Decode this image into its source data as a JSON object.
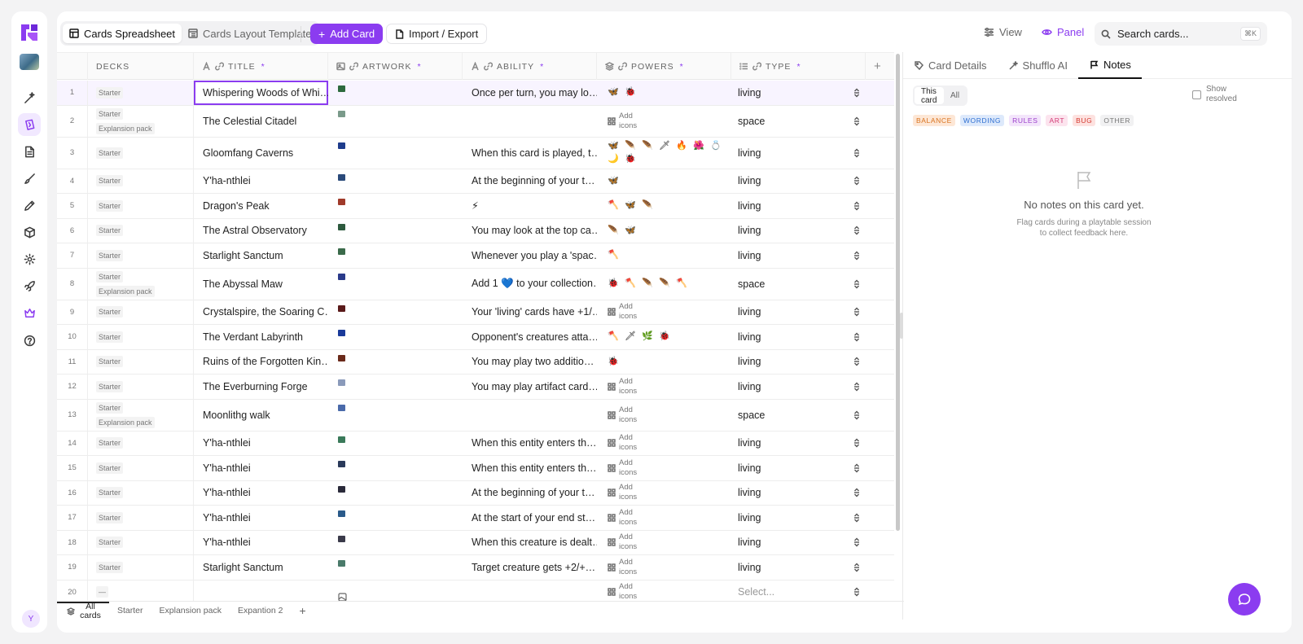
{
  "header": {
    "tabs": [
      {
        "label": "Cards Spreadsheet",
        "active": true
      },
      {
        "label": "Cards Layout Template",
        "active": false
      }
    ],
    "add_card_label": "Add Card",
    "import_export_label": "Import / Export",
    "view_label": "View",
    "panel_label": "Panel",
    "search_placeholder": "Search cards...",
    "search_shortcut": "⌘K"
  },
  "sidebar": {
    "items": [
      "wand-icon",
      "cards-icon",
      "document-icon",
      "brush-icon",
      "pen-icon",
      "package-icon",
      "settings-icon",
      "rocket-icon",
      "crown-icon",
      "help-icon"
    ],
    "active_item": "cards-icon",
    "avatar_initial": "Y"
  },
  "columns": [
    {
      "label": "DECKS",
      "required": false
    },
    {
      "label": "TITLE",
      "required": true
    },
    {
      "label": "ARTWORK",
      "required": true
    },
    {
      "label": "ABILITY",
      "required": true
    },
    {
      "label": "POWERS",
      "required": true
    },
    {
      "label": "TYPE",
      "required": true
    }
  ],
  "add_icons_label": "Add icons",
  "type_placeholder": "Select...",
  "colors": {
    "accent": "#8b3cf0"
  },
  "rows": [
    {
      "num": "1",
      "decks": [
        "Starter"
      ],
      "title": "Whispering Woods of Whi…",
      "ability": "Once per turn, you may lo…",
      "powers": [
        "🦋",
        "🐞"
      ],
      "type": "living",
      "art": "#2d6a3e"
    },
    {
      "num": "2",
      "decks": [
        "Starter",
        "Explansion pack"
      ],
      "title": "The Celestial Citadel",
      "ability": "",
      "powers": [],
      "type": "space",
      "art": "#7a9a8a"
    },
    {
      "num": "3",
      "decks": [
        "Starter"
      ],
      "title": "Gloomfang Caverns",
      "ability": "When this card is played, t…",
      "powers": [
        "🦋",
        "🪶",
        "🪶",
        "🗡",
        "🔥",
        "🌺",
        "💍",
        "🌙",
        "🐞"
      ],
      "type": "living",
      "art": "#1e3c8c"
    },
    {
      "num": "4",
      "decks": [
        "Starter"
      ],
      "title": "Y'ha-nthlei",
      "ability": "At the beginning of your t…",
      "powers": [
        "🦋"
      ],
      "type": "living",
      "art": "#2a4a7a"
    },
    {
      "num": "5",
      "decks": [
        "Starter"
      ],
      "title": "Dragon's Peak",
      "ability": "⚡",
      "powers": [
        "🪓",
        "🦋",
        "🪶"
      ],
      "type": "living",
      "art": "#a03a2a"
    },
    {
      "num": "6",
      "decks": [
        "Starter"
      ],
      "title": "The Astral Observatory",
      "ability": "You may look at the top ca…",
      "powers": [
        "🪶",
        "🦋"
      ],
      "type": "living",
      "art": "#2d5a3e"
    },
    {
      "num": "7",
      "decks": [
        "Starter"
      ],
      "title": "Starlight Sanctum",
      "ability": "Whenever you play a 'spac…",
      "powers": [
        "🪓"
      ],
      "type": "living",
      "art": "#3a6a4a"
    },
    {
      "num": "8",
      "decks": [
        "Starter",
        "Explansion pack"
      ],
      "title": "The Abyssal Maw",
      "ability": "Add 1 💙 to your collection…",
      "powers": [
        "🐞",
        "🪓",
        "🪶",
        "🪶",
        "🪓"
      ],
      "type": "space",
      "art": "#2a3a8a"
    },
    {
      "num": "9",
      "decks": [
        "Starter"
      ],
      "title": "Crystalspire, the Soaring C…",
      "ability": "Your 'living' cards have +1/…",
      "powers": [],
      "type": "living",
      "art": "#5a1a1a"
    },
    {
      "num": "10",
      "decks": [
        "Starter"
      ],
      "title": "The Verdant Labyrinth",
      "ability": "Opponent's creatures atta…",
      "powers": [
        "🪓",
        "🗡",
        "🌿",
        "🐞"
      ],
      "type": "living",
      "art": "#1a3a9a"
    },
    {
      "num": "11",
      "decks": [
        "Starter"
      ],
      "title": "Ruins of the Forgotten Kin…",
      "ability": "You may play two additio…",
      "powers": [
        "🐞"
      ],
      "type": "living",
      "art": "#6a2a1a"
    },
    {
      "num": "12",
      "decks": [
        "Starter"
      ],
      "title": "The Everburning Forge",
      "ability": "You may play artifact card…",
      "powers": [],
      "type": "living",
      "art": "#8a9aba"
    },
    {
      "num": "13",
      "decks": [
        "Starter",
        "Explansion pack"
      ],
      "title": "Moonlithg walk",
      "ability": "",
      "powers": [],
      "type": "space",
      "art": "#4a6aaa"
    },
    {
      "num": "14",
      "decks": [
        "Starter"
      ],
      "title": "Y'ha-nthlei",
      "ability": "When this entity enters th…",
      "powers": [],
      "type": "living",
      "art": "#3a7a5a"
    },
    {
      "num": "15",
      "decks": [
        "Starter"
      ],
      "title": "Y'ha-nthlei",
      "ability": "When this entity enters th…",
      "powers": [],
      "type": "living",
      "art": "#2a3a5a"
    },
    {
      "num": "16",
      "decks": [
        "Starter"
      ],
      "title": "Y'ha-nthlei",
      "ability": "At the beginning of your t…",
      "powers": [],
      "type": "living",
      "art": "#2a2a3a"
    },
    {
      "num": "17",
      "decks": [
        "Starter"
      ],
      "title": "Y'ha-nthlei",
      "ability": "At the start of your end st…",
      "powers": [],
      "type": "living",
      "art": "#2a5a8a"
    },
    {
      "num": "18",
      "decks": [
        "Starter"
      ],
      "title": "Y'ha-nthlei",
      "ability": "When this creature is dealt…",
      "powers": [],
      "type": "living",
      "art": "#3a3a4a"
    },
    {
      "num": "19",
      "decks": [
        "Starter"
      ],
      "title": "Starlight Sanctum",
      "ability": "Target creature gets +2/+…",
      "powers": [],
      "type": "living",
      "art": "#4a7a6a"
    },
    {
      "num": "20",
      "decks": [
        "—"
      ],
      "title": "",
      "ability": "",
      "powers": [],
      "type": "",
      "art": ""
    }
  ],
  "bottom_tabs": [
    "All cards",
    "Starter",
    "Explansion pack",
    "Expantion 2"
  ],
  "panel": {
    "tabs": [
      "Card Details",
      "Shufflo AI",
      "Notes"
    ],
    "active_tab": "Notes",
    "scope": [
      "This card",
      "All"
    ],
    "show_resolved_label": "Show resolved",
    "chips": [
      {
        "label": "BALANCE",
        "bg": "#fde7d6",
        "fg": "#d9731f"
      },
      {
        "label": "WORDING",
        "bg": "#dde9fb",
        "fg": "#2f6fd1"
      },
      {
        "label": "RULES",
        "bg": "#f3e5fb",
        "fg": "#9c3fcb"
      },
      {
        "label": "ART",
        "bg": "#fce4ee",
        "fg": "#d33b76"
      },
      {
        "label": "BUG",
        "bg": "#fde2e0",
        "fg": "#d4382f"
      },
      {
        "label": "OTHER",
        "bg": "#f1f1f2",
        "fg": "#777777"
      }
    ],
    "empty_title": "No notes on this card yet.",
    "empty_sub": "Flag cards during a playtable session to collect feedback here."
  }
}
